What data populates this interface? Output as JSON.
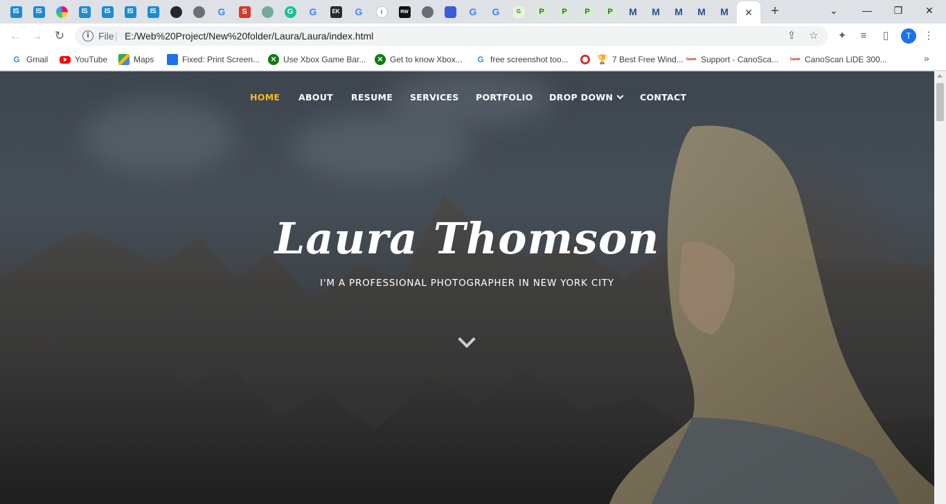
{
  "browser": {
    "tabs": [
      {
        "icon": "is-icon",
        "text": "IS"
      },
      {
        "icon": "is-icon",
        "text": "IS"
      },
      {
        "icon": "pinwheel-icon",
        "text": ""
      },
      {
        "icon": "is-icon",
        "text": "IS"
      },
      {
        "icon": "is-icon",
        "text": "IS"
      },
      {
        "icon": "is-icon",
        "text": "IS"
      },
      {
        "icon": "is-icon",
        "text": "IS"
      },
      {
        "icon": "github-icon",
        "text": ""
      },
      {
        "icon": "globe-icon",
        "text": ""
      },
      {
        "icon": "google-icon",
        "text": "G"
      },
      {
        "icon": "s-icon",
        "text": "S"
      },
      {
        "icon": "chatgpt-icon",
        "text": ""
      },
      {
        "icon": "grammarly-icon",
        "text": "G"
      },
      {
        "icon": "google-icon",
        "text": "G"
      },
      {
        "icon": "ek-icon",
        "text": "EK"
      },
      {
        "icon": "google-icon",
        "text": "G"
      },
      {
        "icon": "info-icon",
        "text": "i"
      },
      {
        "icon": "rw-icon",
        "text": "RW"
      },
      {
        "icon": "globe-icon",
        "text": ""
      },
      {
        "icon": "blue-app-icon",
        "text": ""
      },
      {
        "icon": "google-icon",
        "text": "G"
      },
      {
        "icon": "google-icon",
        "text": "G"
      },
      {
        "icon": "green-app-icon",
        "text": "G"
      },
      {
        "icon": "p-icon",
        "text": "P"
      },
      {
        "icon": "p-icon",
        "text": "P"
      },
      {
        "icon": "p-icon",
        "text": "P"
      },
      {
        "icon": "p-icon",
        "text": "P"
      },
      {
        "icon": "m-icon",
        "text": "M"
      },
      {
        "icon": "m-icon",
        "text": "M"
      },
      {
        "icon": "m-icon",
        "text": "M"
      },
      {
        "icon": "m-icon",
        "text": "M"
      },
      {
        "icon": "m-icon",
        "text": "M"
      }
    ],
    "active_tab_close": "✕",
    "new_tab": "+",
    "window_controls": {
      "tab_search": "⌄",
      "minimize": "—",
      "restore": "❐",
      "close": "✕"
    },
    "nav": {
      "back": "←",
      "forward": "→",
      "reload": "↻"
    },
    "address": {
      "scheme_label": "File",
      "separator": "|",
      "url": "E:/Web%20Project/New%20folder/Laura/Laura/index.html"
    },
    "omnibox_icons": {
      "share": "⇪",
      "star": "☆"
    },
    "toolbar_icons": {
      "extensions": "✦",
      "media": "≡",
      "sidepanel": "▯",
      "profile": "T",
      "menu": "⋮"
    },
    "bookmarks": [
      {
        "label": "Gmail",
        "icon": "google-icon"
      },
      {
        "label": "YouTube",
        "icon": "youtube-icon"
      },
      {
        "label": "Maps",
        "icon": "maps-icon"
      },
      {
        "label": "Fixed: Print Screen...",
        "icon": "fixed-icon"
      },
      {
        "label": "Use Xbox Game Bar...",
        "icon": "xbox-icon"
      },
      {
        "label": "Get to know Xbox...",
        "icon": "xbox-icon"
      },
      {
        "label": "free screenshot too...",
        "icon": "google-icon"
      },
      {
        "label": "",
        "icon": "record-icon"
      },
      {
        "label": "7 Best Free Wind...",
        "icon": "trophy-icon"
      },
      {
        "label": "Support - CanoSca...",
        "icon": "canon-icon"
      },
      {
        "label": "CanoScan LiDE 300...",
        "icon": "canon-icon"
      }
    ],
    "bookmarks_more": "»"
  },
  "site": {
    "nav": [
      {
        "label": "HOME",
        "active": true
      },
      {
        "label": "ABOUT",
        "active": false
      },
      {
        "label": "RESUME",
        "active": false
      },
      {
        "label": "SERVICES",
        "active": false
      },
      {
        "label": "PORTFOLIO",
        "active": false
      },
      {
        "label": "DROP DOWN",
        "active": false,
        "dropdown": true
      },
      {
        "label": "CONTACT",
        "active": false
      }
    ],
    "hero": {
      "name": "Laura Thomson",
      "subtitle": "I'M A PROFESSIONAL PHOTOGRAPHER IN NEW YORK CITY"
    },
    "colors": {
      "accent": "#ffb727",
      "nav_text": "#ffffff"
    }
  }
}
